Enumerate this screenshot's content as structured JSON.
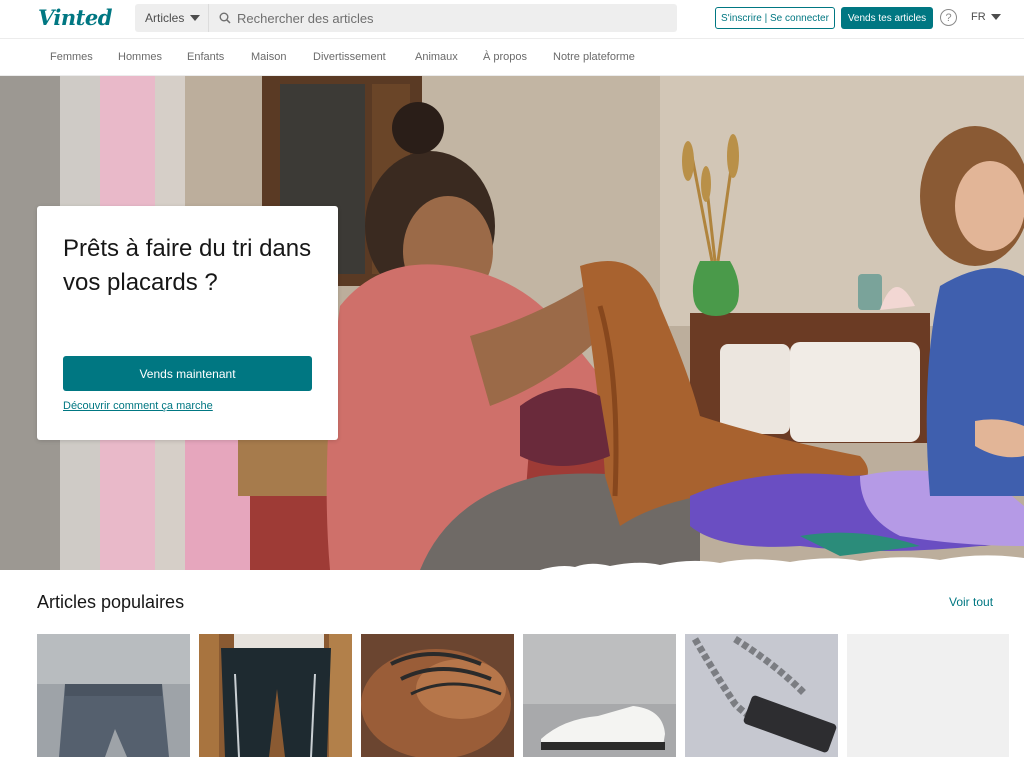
{
  "header": {
    "logo": "Vinted",
    "search": {
      "category": "Articles",
      "placeholder": "Rechercher des articles"
    },
    "login_label": "S'inscrire | Se connecter",
    "sell_label": "Vends tes articles",
    "help_label": "?",
    "language": "FR"
  },
  "nav": {
    "items": [
      "Femmes",
      "Hommes",
      "Enfants",
      "Maison",
      "Divertissement",
      "Animaux",
      "À propos",
      "Notre plateforme"
    ]
  },
  "hero": {
    "title": "Prêts à faire du tri dans vos placards ?",
    "cta_label": "Vends maintenant",
    "link_label": "Découvrir comment ça marche"
  },
  "popular": {
    "title": "Articles populaires",
    "see_all_label": "Voir tout"
  },
  "colors": {
    "brand": "#007782",
    "search_bg": "#eeeeee"
  }
}
